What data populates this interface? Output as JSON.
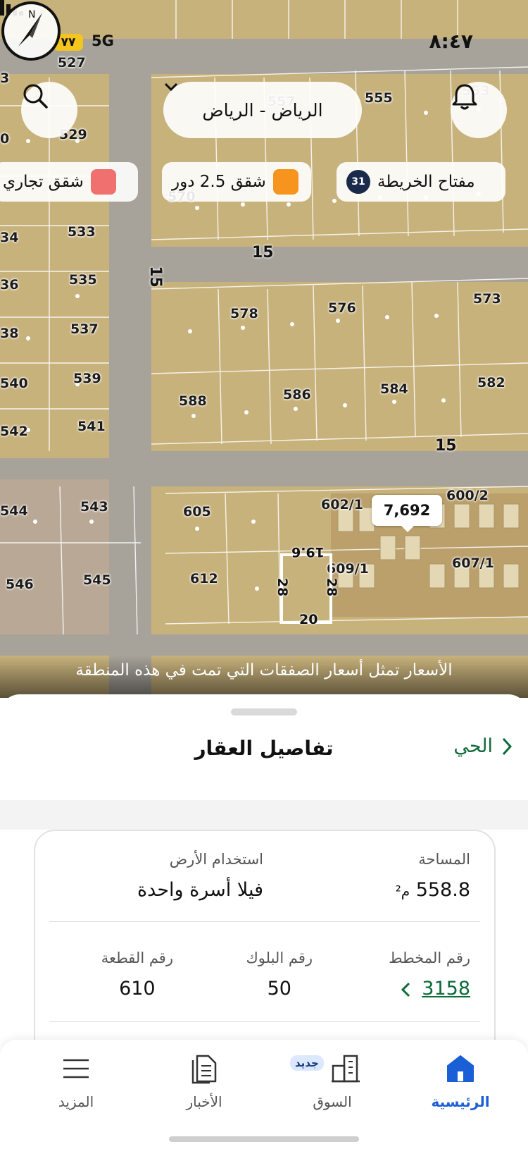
{
  "status_bar": {
    "time": "٨:٤٧",
    "network": "5G",
    "battery": "٧٧"
  },
  "map": {
    "city_selector": "الرياض - الرياض",
    "filters": {
      "commercial": "شقق تجاري",
      "apartments": "شقق 2.5 دور",
      "map_key": "مفتاح الخريطة",
      "map_key_count": "31"
    },
    "filter_colors": {
      "commercial": "#f07070",
      "apartments": "#f7941d"
    },
    "compass_label": "N",
    "plot_labels": [
      {
        "text": "527"
      },
      {
        "text": "529"
      },
      {
        "text": "533"
      },
      {
        "text": "535"
      },
      {
        "text": "537"
      },
      {
        "text": "539"
      },
      {
        "text": "541"
      },
      {
        "text": "543"
      },
      {
        "text": "544"
      },
      {
        "text": "545"
      },
      {
        "text": "546"
      },
      {
        "text": "555"
      },
      {
        "text": "557"
      },
      {
        "text": "553"
      },
      {
        "text": "570"
      },
      {
        "text": "573"
      },
      {
        "text": "576"
      },
      {
        "text": "578"
      },
      {
        "text": "582"
      },
      {
        "text": "584"
      },
      {
        "text": "586"
      },
      {
        "text": "588"
      },
      {
        "text": "600/2"
      },
      {
        "text": "602/1"
      },
      {
        "text": "605"
      },
      {
        "text": "607/1"
      },
      {
        "text": "609/1"
      },
      {
        "text": "612"
      },
      {
        "text": "3"
      },
      {
        "text": "0"
      },
      {
        "text": "34"
      },
      {
        "text": "36"
      },
      {
        "text": "38"
      },
      {
        "text": "540"
      },
      {
        "text": "542"
      }
    ],
    "street_labels": [
      "15",
      "15",
      "15"
    ],
    "price_tag": "7,692",
    "selected_plot_dims": {
      "top": "19.6",
      "left": "28",
      "right": "28",
      "bottom": "20"
    },
    "caption": "الأسعار تمثل أسعار الصفقات التي تمت في هذه المنطقة"
  },
  "sheet": {
    "title": "تفاصيل العقار",
    "back_label": "الحي",
    "area": {
      "label": "المساحة",
      "value": "558.8",
      "unit": "م²"
    },
    "land_use": {
      "label": "استخدام الأرض",
      "value": "فيلا أسرة واحدة"
    },
    "plan_number": {
      "label": "رقم المخطط",
      "value": "3158"
    },
    "block_number": {
      "label": "رقم البلوك",
      "value": "50"
    },
    "parcel_number": {
      "label": "رقم القطعة",
      "value": "610"
    }
  },
  "tabbar": {
    "home": "الرئيسية",
    "market": "السوق",
    "market_badge": "جديد",
    "news": "الأخبار",
    "more": "المزيد"
  },
  "colors": {
    "accent_green": "#0d6b3a",
    "accent_blue": "#1b5fd6",
    "land": "#c9b47e"
  }
}
